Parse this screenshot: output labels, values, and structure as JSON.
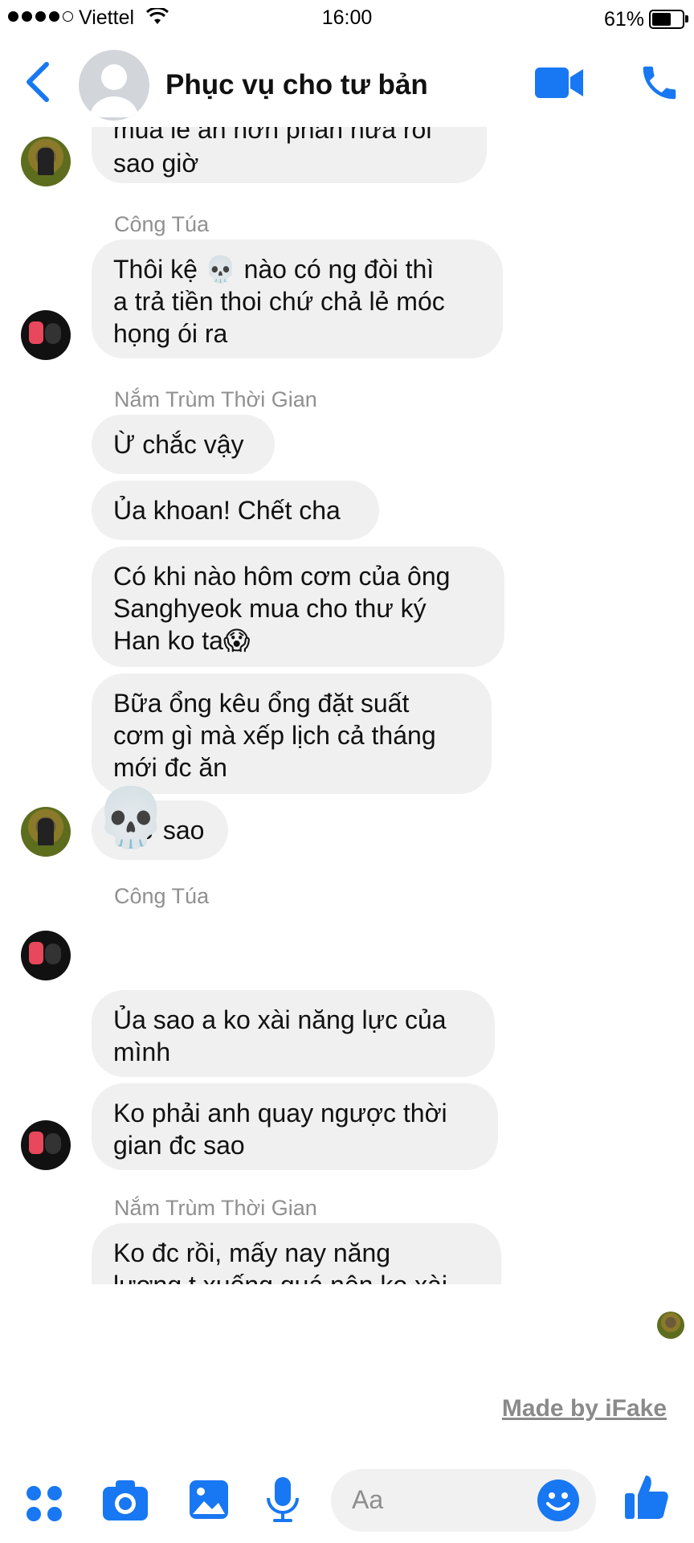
{
  "status": {
    "carrier": "Viettel",
    "time": "16:00",
    "battery": "61%"
  },
  "header": {
    "title": "Phục vụ cho tư bản"
  },
  "chat": {
    "partial_top": "mua lẻ ăn hơn phần nửa rồi\nsao giờ",
    "sender1": "Công Túa",
    "m1": "Thôi kệ 💀 nào có ng đòi thì\na trả tiền thoi chứ chả lẻ móc\nhọng ói ra",
    "sender2": "Nắm Trùm Thời Gian",
    "m2": "Ừ chắc vậy",
    "m3": "Ủa khoan! Chết cha",
    "m4": "Có khi nào hôm cơm của ông\nSanghyeok mua cho thư ký\nHan ko ta😱",
    "m5": "Bữa ổng kêu ổng đặt suất\ncơm gì mà xếp lịch cả tháng\nmới đc ăn",
    "m6": "Giờ sao",
    "sender3": "Công Túa",
    "skull": "💀",
    "m7": "Ủa sao a ko xài năng lực của\nmình",
    "m8": "Ko phải anh quay ngược thời\ngian đc sao",
    "sender4": "Nắm Trùm Thời Gian",
    "m9": "Ko đc rồi, mấy nay năng\nlượng t xuống quá nên ko xài\nnăng lực đc"
  },
  "watermark": "Made by iFake",
  "composer": {
    "placeholder": "Aa"
  },
  "colors": {
    "accent": "#1877f2",
    "bubble": "#f0f0f0",
    "sender": "#909090"
  }
}
